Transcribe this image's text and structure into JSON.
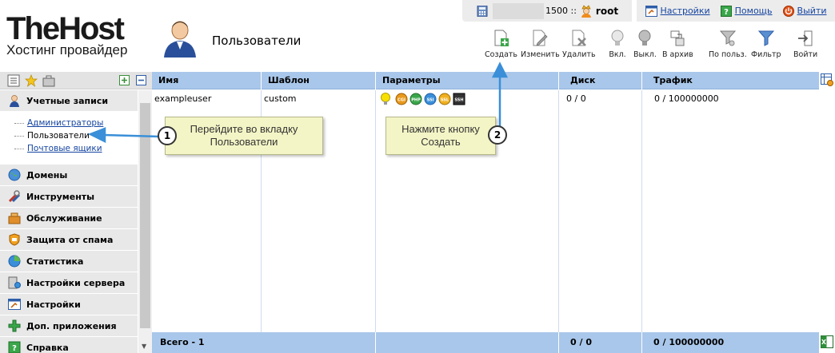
{
  "logo": {
    "brand": "TheHost",
    "subtitle": "Хостинг провайдер"
  },
  "page": {
    "title": "Пользователи"
  },
  "userbar": {
    "value": "1500 ::",
    "username": "root"
  },
  "links": [
    {
      "label": "Настройки"
    },
    {
      "label": "Помощь"
    },
    {
      "label": "Выйти"
    }
  ],
  "toolbar": [
    {
      "label": "Создать"
    },
    {
      "label": "Изменить"
    },
    {
      "label": "Удалить"
    },
    {
      "label": "Вкл."
    },
    {
      "label": "Выкл."
    },
    {
      "label": "В архив"
    },
    {
      "label": "По польз."
    },
    {
      "label": "Фильтр"
    },
    {
      "label": "Войти"
    }
  ],
  "sidebar": {
    "active_group": "Учетные записи",
    "sub_items": [
      {
        "label": "Администраторы"
      },
      {
        "label": "Пользователи"
      },
      {
        "label": "Почтовые ящики"
      }
    ],
    "groups": [
      {
        "label": "Домены"
      },
      {
        "label": "Инструменты"
      },
      {
        "label": "Обслуживание"
      },
      {
        "label": "Защита от спама"
      },
      {
        "label": "Статистика"
      },
      {
        "label": "Настройки сервера"
      },
      {
        "label": "Настройки"
      },
      {
        "label": "Доп. приложения"
      },
      {
        "label": "Справка"
      }
    ]
  },
  "table": {
    "columns": [
      "Имя",
      "Шаблон",
      "Параметры",
      "Диск",
      "Трафик"
    ],
    "rows": [
      {
        "name": "exampleuser",
        "template": "custom",
        "params": [
          "lamp",
          "CGI",
          "PHP",
          "SSI",
          "SSL",
          "SSH"
        ],
        "disk": "0 / 0",
        "traffic": "0 / 100000000"
      }
    ],
    "footer": {
      "total": "Всего - 1",
      "disk": "0 / 0",
      "traffic": "0 / 100000000"
    }
  },
  "callouts": [
    {
      "number": "1",
      "text_line1": "Перейдите во вкладку",
      "text_line2": "Пользователи"
    },
    {
      "number": "2",
      "text_line1": "Нажмите кнопку",
      "text_line2": "Создать"
    }
  ],
  "colors": {
    "header_blue": "#a9c7ea",
    "link": "#1645a0",
    "callout_bg": "#f4f5c6",
    "arrow": "#3a8fd8"
  }
}
